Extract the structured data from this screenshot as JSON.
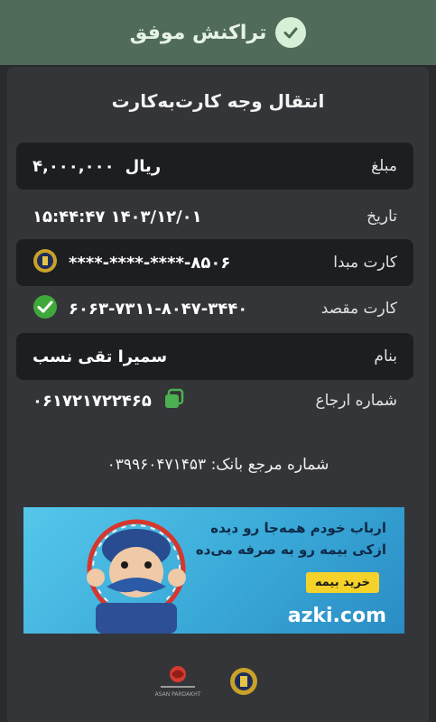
{
  "header": {
    "title": "تراکنش موفق",
    "icon": "check-icon",
    "color": "#516b5a"
  },
  "page": {
    "title": "انتقال وجه کارت‌به‌کارت"
  },
  "rows": {
    "amount": {
      "label": "مبلغ",
      "value": "۴,۰۰۰,۰۰۰",
      "unit": "ریال"
    },
    "date": {
      "label": "تاریخ",
      "value": "۱۵:۴۴:۴۷ ۱۴۰۳/۱۲/۰۱"
    },
    "source_card": {
      "label": "کارت مبدا",
      "value": "****-****-****-۸۵۰۶",
      "icon": "bank-melli-logo-icon"
    },
    "dest_card": {
      "label": "کارت مقصد",
      "value": "۶۰۶۳-۷۳۱۱-۸۰۴۷-۳۴۴۰",
      "icon": "green-check-icon"
    },
    "recipient": {
      "label": "بنام",
      "value": "سمیرا تقی نسب"
    },
    "reference": {
      "label": "شماره ارجاع",
      "value": "۰۶۱۷۲۱۷۲۲۴۶۵",
      "icon": "copy-icon"
    }
  },
  "bank_reference": {
    "label": "شماره مرجع بانک:",
    "value": "۰۳۹۹۶۰۴۷۱۴۵۳"
  },
  "banner": {
    "line1": "ارباب خودم همه‌جا رو دیده",
    "line2": "ازکی بیمه رو به صرفه می‌ده",
    "cta": "خرید بیمه",
    "brand": "azki.com"
  },
  "footer": {
    "logos": [
      "asan-pardakht-logo-icon",
      "bank-melli-logo-icon"
    ],
    "asan_text": "ASAN PARDAKHT"
  }
}
